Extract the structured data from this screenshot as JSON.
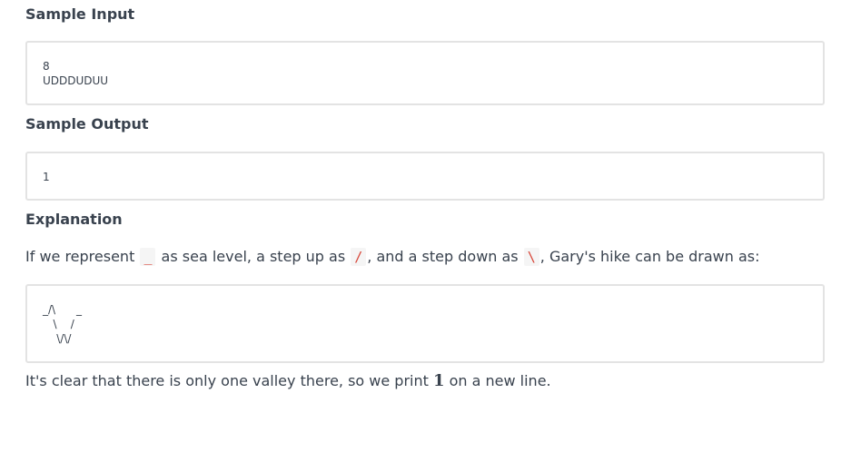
{
  "sample_input": {
    "heading": "Sample Input",
    "lines": [
      "8",
      "UDDDUDUU"
    ]
  },
  "sample_output": {
    "heading": "Sample Output",
    "lines": [
      "1"
    ]
  },
  "explanation": {
    "heading": "Explanation",
    "text_1": "If we represent ",
    "code_sea": "_",
    "text_2": " as sea level, a step up as ",
    "code_up": "/",
    "text_3": ", and a step down as ",
    "code_down": "\\",
    "text_4": ", Gary's hike can be drawn as:",
    "hike_drawing": "_/\\      _\n   \\    /\n    \\/\\/",
    "conclusion_1": "It's clear that there is only one valley there, so we print ",
    "conclusion_num": "1",
    "conclusion_2": " on a new line."
  },
  "colors": {
    "text": "#39424e",
    "code_red": "#d8473a",
    "box_border": "#e3e3e3"
  }
}
